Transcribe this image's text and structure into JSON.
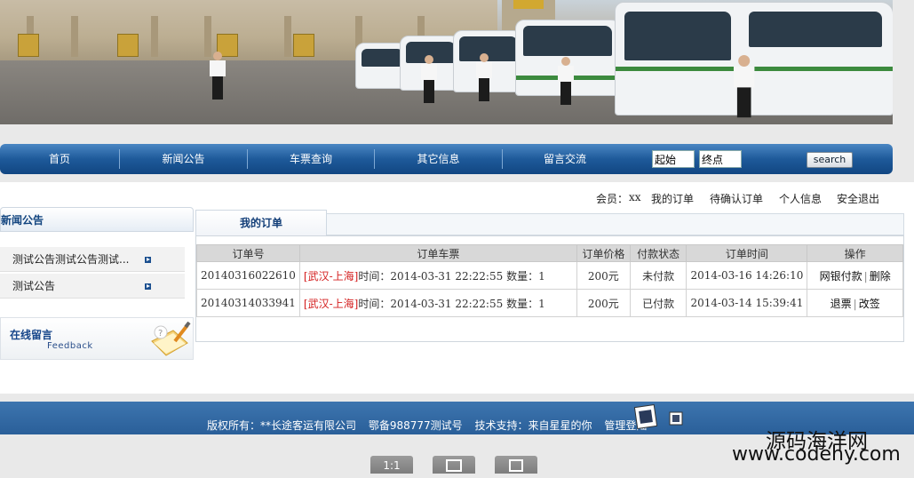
{
  "nav": {
    "items": [
      "首页",
      "新闻公告",
      "车票查询",
      "其它信息",
      "留言交流"
    ],
    "search": {
      "from_value": "起始",
      "to_value": "终点",
      "button_label": "search"
    }
  },
  "user_bar": {
    "member_label": "会员：",
    "member_name": "xx",
    "links": [
      "我的订单",
      "待确认订单",
      "个人信息",
      "安全退出"
    ]
  },
  "sidebar": {
    "title": "新闻公告",
    "items": [
      "测试公告测试公告测试...",
      "测试公告"
    ],
    "feedback": {
      "title": "在线留言",
      "subtitle": "Feedback"
    }
  },
  "orders": {
    "tab_label": "我的订单",
    "columns": [
      "订单号",
      "订单车票",
      "订单价格",
      "付款状态",
      "订单时间",
      "操作"
    ],
    "rows": [
      {
        "id": "20140316022610",
        "route": "[武汉-上海]",
        "time_label": "时间：",
        "time": "2014-03-31 22:22:55",
        "qty_label": "数量：",
        "qty": "1",
        "price": "200元",
        "status": "未付款",
        "order_time": "2014-03-16 14:26:10",
        "actions": [
          "网银付款",
          "删除"
        ]
      },
      {
        "id": "20140314033941",
        "route": "[武汉-上海]",
        "time_label": "时间：",
        "time": "2014-03-31 22:22:55",
        "qty_label": "数量：",
        "qty": "1",
        "price": "200元",
        "status": "已付款",
        "order_time": "2014-03-14 15:39:41",
        "actions": [
          "退票",
          "改签"
        ]
      }
    ]
  },
  "footer": {
    "copyright": "版权所有：**长途客运有限公司",
    "icp": "鄂备988777测试号",
    "support": "技术支持：来自星星的你",
    "admin": "管理登陆"
  },
  "watermark": {
    "cn": "源码海洋网",
    "url": "www.codehy.com"
  },
  "viewer": {
    "actual_size": "1:1"
  },
  "colors": {
    "nav_blue": "#1e5a9a",
    "route_red": "#d42020",
    "footer_blue": "#2a5f99"
  }
}
